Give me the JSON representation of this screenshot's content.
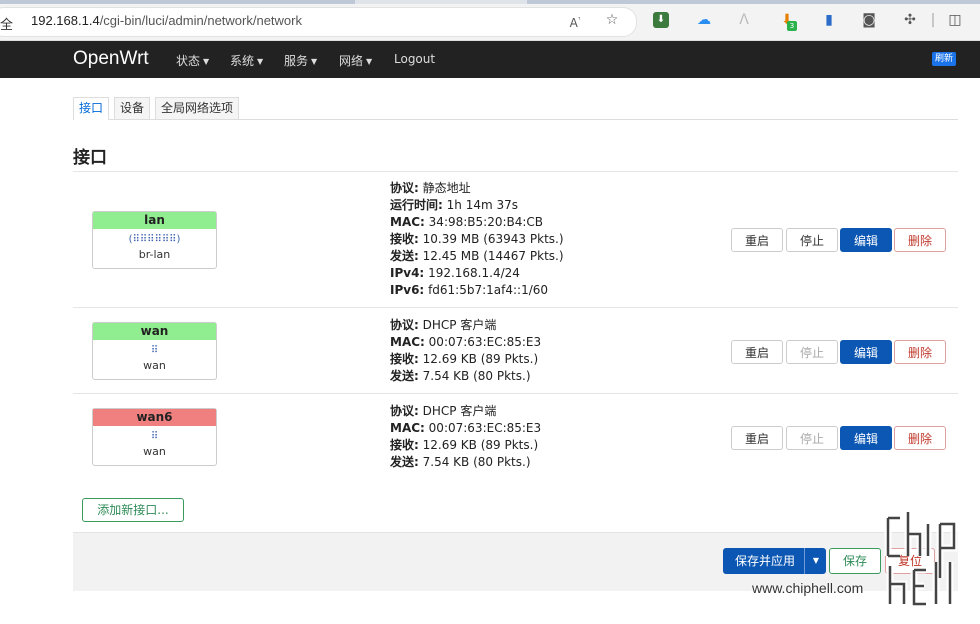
{
  "browser": {
    "addr_prefix": "全",
    "address_host": "192.168.1.4",
    "address_path": "/cgi-bin/luci/admin/network/network",
    "icons": [
      "read-aloud-icon",
      "favorite-star-icon",
      "extension-icon",
      "cloud-icon",
      "extension-icon",
      "download-icon",
      "extension-icon",
      "camera-icon",
      "extensions-icon",
      "split-screen-icon"
    ],
    "download_badge": "3"
  },
  "header": {
    "brand": "OpenWrt",
    "menu": [
      "状态",
      "系统",
      "服务",
      "网络",
      "Logout"
    ],
    "refresh": "刷新"
  },
  "tabs": [
    "接口",
    "设备",
    "全局网络选项"
  ],
  "page_title": "接口",
  "interfaces": [
    {
      "name": "lan",
      "status_color": "#90ee90",
      "icons_text": "(⠿⠿⠿⠿⠿⠿)",
      "device": "br-lan",
      "info": [
        {
          "k": "协议:",
          "v": "静态地址"
        },
        {
          "k": "运行时间:",
          "v": "1h 14m 37s"
        },
        {
          "k": "MAC:",
          "v": "34:98:B5:20:B4:CB"
        },
        {
          "k": "接收:",
          "v": "10.39 MB (63943 Pkts.)"
        },
        {
          "k": "发送:",
          "v": "12.45 MB (14467 Pkts.)"
        },
        {
          "k": "IPv4:",
          "v": "192.168.1.4/24"
        },
        {
          "k": "IPv6:",
          "v": "fd61:5b7:1af4::1/60"
        }
      ],
      "stop_disabled": false
    },
    {
      "name": "wan",
      "status_color": "#90ee90",
      "icons_text": "⠿",
      "device": "wan",
      "info": [
        {
          "k": "协议:",
          "v": "DHCP 客户端"
        },
        {
          "k": "MAC:",
          "v": "00:07:63:EC:85:E3"
        },
        {
          "k": "接收:",
          "v": "12.69 KB (89 Pkts.)"
        },
        {
          "k": "发送:",
          "v": "7.54 KB (80 Pkts.)"
        }
      ],
      "stop_disabled": true
    },
    {
      "name": "wan6",
      "status_color": "#f08080",
      "icons_text": "⠿",
      "device": "wan",
      "info": [
        {
          "k": "协议:",
          "v": "DHCP 客户端"
        },
        {
          "k": "MAC:",
          "v": "00:07:63:EC:85:E3"
        },
        {
          "k": "接收:",
          "v": "12.69 KB (89 Pkts.)"
        },
        {
          "k": "发送:",
          "v": "7.54 KB (80 Pkts.)"
        }
      ],
      "stop_disabled": true
    }
  ],
  "row_buttons": {
    "restart": "重启",
    "stop": "停止",
    "edit": "编辑",
    "delete": "删除"
  },
  "add_interface": "添加新接口...",
  "footer": {
    "save_apply": "保存并应用",
    "save": "保存",
    "reset": "复位"
  },
  "watermark": {
    "text": "www.chiphell.com",
    "logo": "chip hell"
  }
}
